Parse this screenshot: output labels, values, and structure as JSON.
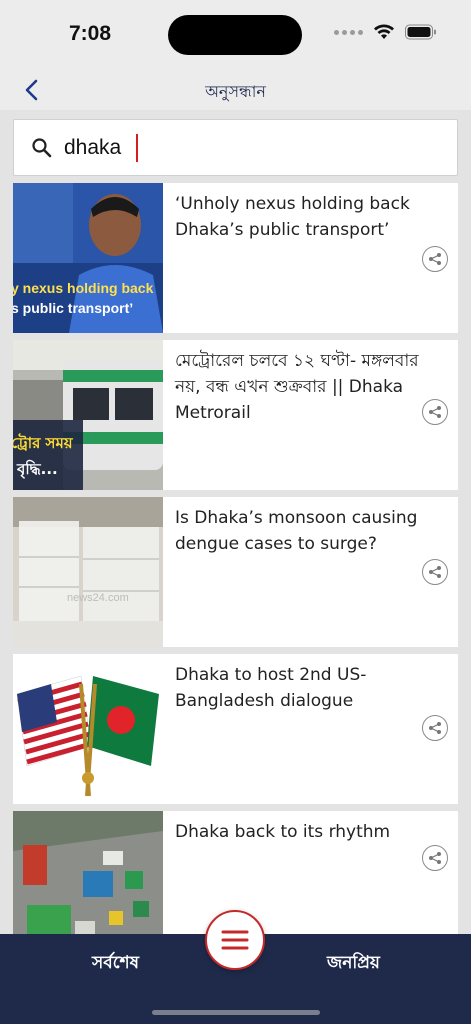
{
  "status_bar": {
    "time": "7:08"
  },
  "nav": {
    "title": "অনুসন্ধান"
  },
  "search": {
    "value": "dhaka"
  },
  "results": [
    {
      "title": "‘Unholy nexus holding back Dhaka’s public transport’",
      "thumb_caption_line1": "y nexus holding back",
      "thumb_caption_line2": "s public transport’"
    },
    {
      "title": "মেট্রোরেল চলবে ১২ ঘণ্টা- মঙ্গলবার নয়, বন্ধ এখন শুক্রবার || Dhaka Metrorail",
      "thumb_caption_line1": "ট্রোর সময়",
      "thumb_caption_line2": "বৃদ্ধি..."
    },
    {
      "title": "Is Dhaka’s monsoon causing dengue cases to surge?",
      "thumb_watermark": "news24.com"
    },
    {
      "title": "Dhaka to host 2nd US-Bangladesh dialogue"
    },
    {
      "title": "Dhaka back to its rhythm"
    }
  ],
  "bottom_bar": {
    "latest_label": "সর্বশেষ",
    "popular_label": "জনপ্রিয়"
  },
  "colors": {
    "navy": "#1f2a4b",
    "accent_red": "#c42a2a"
  }
}
